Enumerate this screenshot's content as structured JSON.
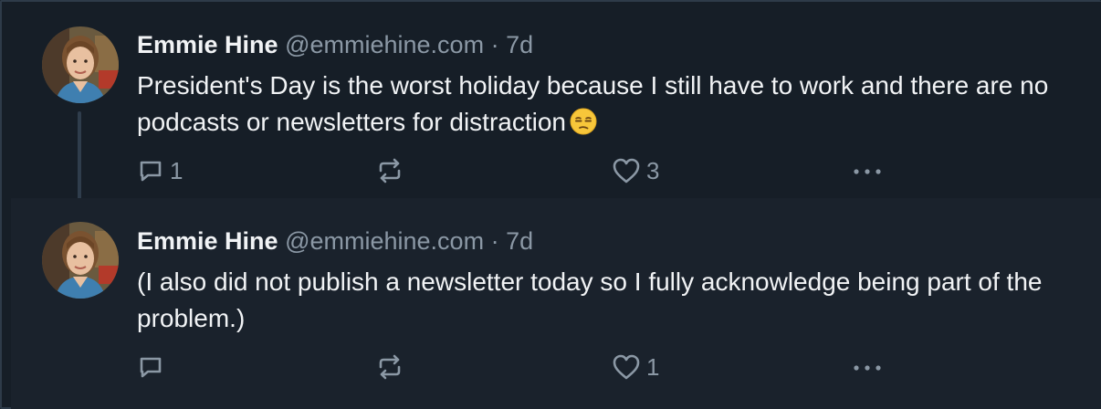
{
  "posts": [
    {
      "author_name": "Emmie Hine",
      "handle": "@emmiehine.com",
      "separator": "·",
      "time": "7d",
      "text": "President's Day is the worst holiday because I still have to work and there are no podcasts or newsletters for distraction",
      "emoji": "unamused-face",
      "reply_count": "1",
      "repost_count": "",
      "like_count": "3"
    },
    {
      "author_name": "Emmie Hine",
      "handle": "@emmiehine.com",
      "separator": "·",
      "time": "7d",
      "text": "(I also did not publish a newsletter today so I fully acknowledge being part of the problem.)",
      "reply_count": "",
      "repost_count": "",
      "like_count": "1"
    }
  ],
  "icons": {
    "reply": "reply-icon",
    "repost": "repost-icon",
    "like": "heart-icon",
    "more": "more-options-icon"
  },
  "colors": {
    "background": "#161e27",
    "second_post_background": "#1a222c",
    "text": "#f1f3f5",
    "muted": "#8b98a5",
    "thread_line": "#2f3d4c"
  }
}
